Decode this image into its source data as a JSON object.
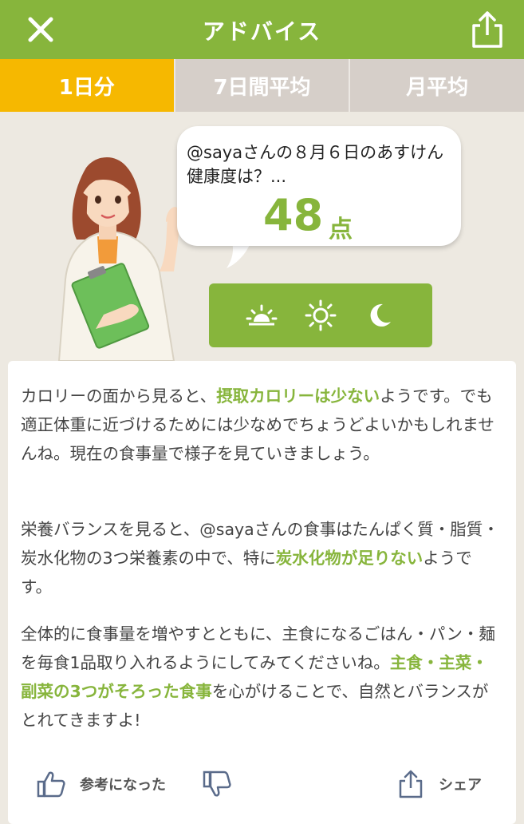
{
  "header": {
    "title": "アドバイス",
    "close_icon": "close-icon",
    "share_icon": "share-icon"
  },
  "tabs": [
    {
      "label": "1日分",
      "active": true
    },
    {
      "label": "7日間平均",
      "active": false
    },
    {
      "label": "月平均",
      "active": false
    }
  ],
  "advisor": {
    "question": "@sayaさんの８月６日のあすけん健康度は？...",
    "score": "48",
    "score_unit": "点"
  },
  "meal_times": [
    {
      "name": "morning",
      "icon": "sunrise-icon"
    },
    {
      "name": "noon",
      "icon": "sun-icon"
    },
    {
      "name": "night",
      "icon": "moon-icon"
    }
  ],
  "advice": {
    "p1_a": "カロリーの面から見ると、",
    "p1_hl": "摂取カロリーは少ない",
    "p1_b": "ようです。でも適正体重に近づけるためには少なめでちょうどよいかもしれませんね。現在の食事量で様子を見ていきましょう。",
    "p2_a": "栄養バランスを見ると、@sayaさんの食事はたんぱく質・脂質・炭水化物の3つ栄養素の中で、特に",
    "p2_hl": "炭水化物が足りない",
    "p2_b": "ようです。",
    "p3_a": "全体的に食事量を増やすとともに、主食になるごはん・パン・麺を毎食1品取り入れるようにしてみてくださいね。",
    "p3_hl": "主食・主菜・副菜の3つがそろった食事",
    "p3_b": "を心がけることで、自然とバランスがとれてきますよ!"
  },
  "actions": {
    "helpful_label": "参考になった",
    "share_label": "シェア"
  },
  "colors": {
    "brand_green": "#87b53c",
    "tab_active": "#f6b800",
    "tab_inactive": "#d6cfc9",
    "background": "#ede9e1"
  }
}
